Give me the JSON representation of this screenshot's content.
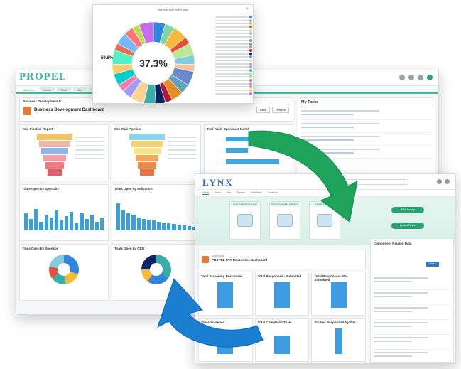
{
  "propel": {
    "logo": "PROPEL",
    "nav_tabs": [
      "Overview",
      "Home",
      "Tools",
      "Sites",
      "Reports"
    ],
    "dashboard_title": "Business Development Dashboard",
    "crumb": "Business Development D...",
    "card_titles": [
      "Trial Pipeline Report",
      "Site Trial Pipeline",
      "Trial Trials Open Last Month",
      "Trials Open by Specialty",
      "Trials Open by Indication",
      "",
      "Trials Open by Sponsor",
      "Trials Open by CRO",
      ""
    ],
    "tasks_title": "My Tasks",
    "button_refresh": "Save",
    "button_view": "Refresh"
  },
  "lynx": {
    "logo": "LYNX",
    "nav_tabs": [
      "Home",
      "Trials",
      "Site",
      "Reports",
      "Feasibility",
      "Contacts"
    ],
    "tiles": [
      "Respond to Opportunities",
      "Review Feasibility Questions",
      "Upload Documents"
    ],
    "btn_one": "Take Survey",
    "btn_two": "Upload Profile",
    "dashboard_subtitle": "Dashboard",
    "dashboard_title": "PROPEL CTA Responses Dashboard",
    "card_titles": [
      "Total Screening Responses",
      "Total Responses - Submitted",
      "Total Responses - Not Submitted",
      "Trials Screened",
      "Total Completed Trials",
      "Studies Responded by Site"
    ],
    "side_title": "Component Related Data",
    "side_button": "Share"
  },
  "popup": {
    "title": "Screen Fail % by Site",
    "center_value": "37.3%",
    "slice_label": "59.6%",
    "close": "×"
  },
  "chart_data": {
    "type": "pie",
    "title": "Screen Fail % by Site",
    "center_label": "37.3%",
    "values": [
      5,
      4,
      6,
      3,
      5,
      4,
      3,
      6,
      4,
      5,
      3,
      4,
      5,
      6,
      4,
      3,
      5,
      4,
      6,
      3,
      5,
      4,
      3,
      6
    ],
    "colors": [
      "#2e86de",
      "#7ed6a5",
      "#f6b93b",
      "#e55039",
      "#b8e994",
      "#82ccdd",
      "#f8c291",
      "#6a89cc",
      "#60a3bc",
      "#e58e26",
      "#b71540",
      "#0c2461",
      "#38ada9",
      "#fad390",
      "#a29bfe",
      "#fd79a8",
      "#00cec9",
      "#fdcb6e",
      "#55efc4",
      "#e17055",
      "#74b9ff",
      "#ff7675",
      "#badc58",
      "#c56cf0"
    ]
  },
  "colors": {
    "propel_accent": "#46b59a",
    "lynx_accent": "#2f6fb1",
    "arrow_green": "#1fa35b",
    "arrow_blue": "#1b7fd1"
  }
}
